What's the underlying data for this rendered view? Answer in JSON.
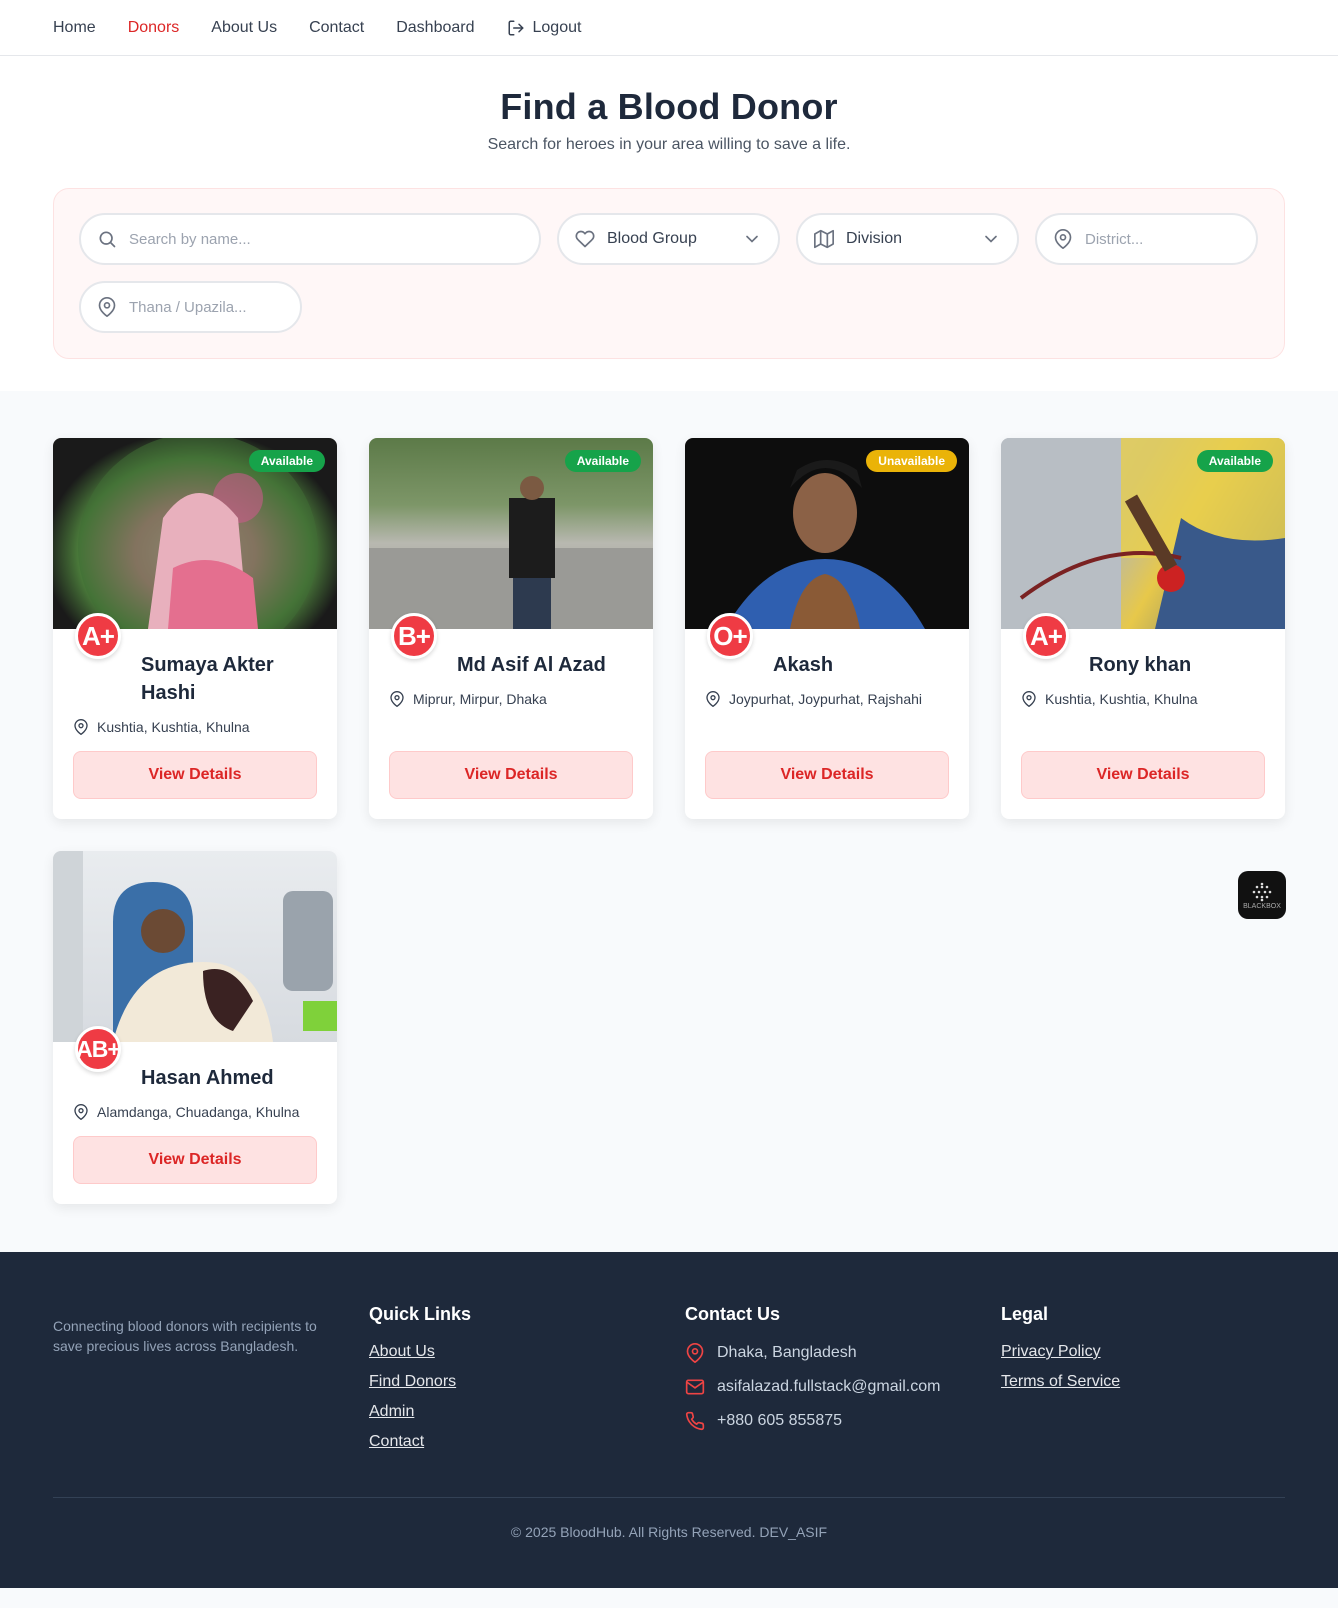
{
  "nav": {
    "items": [
      {
        "label": "Home",
        "active": false
      },
      {
        "label": "Donors",
        "active": true
      },
      {
        "label": "About Us",
        "active": false
      },
      {
        "label": "Contact",
        "active": false
      },
      {
        "label": "Dashboard",
        "active": false
      }
    ],
    "logout_label": "Logout"
  },
  "hero": {
    "title": "Find a Blood Donor",
    "subtitle": "Search for heroes in your area willing to save a life."
  },
  "filters": {
    "search_placeholder": "Search by name...",
    "blood_group": "Blood Group",
    "division": "Division",
    "district_placeholder": "District...",
    "thana_placeholder": "Thana / Upazila..."
  },
  "donors": [
    {
      "name": "Sumaya Akter Hashi",
      "blood_group": "A+",
      "status": "Available",
      "location": "Kushtia, Kushtia, Khulna",
      "button": "View Details"
    },
    {
      "name": "Md Asif Al Azad",
      "blood_group": "B+",
      "status": "Available",
      "location": "Miprur, Mirpur, Dhaka",
      "button": "View Details"
    },
    {
      "name": "Akash",
      "blood_group": "O+",
      "status": "Unavailable",
      "location": "Joypurhat, Joypurhat, Rajshahi",
      "button": "View Details"
    },
    {
      "name": "Rony khan",
      "blood_group": "A+",
      "status": "Available",
      "location": "Kushtia, Kushtia, Khulna",
      "button": "View Details"
    },
    {
      "name": "Hasan Ahmed",
      "blood_group": "AB+",
      "status": "",
      "location": "Alamdanga, Chuadanga, Khulna",
      "button": "View Details"
    }
  ],
  "widget": {
    "label": "BLACKBOX"
  },
  "footer": {
    "about": "Connecting blood donors with recipients to save precious lives across Bangladesh.",
    "quick_links": {
      "title": "Quick Links",
      "items": [
        "About Us",
        "Find Donors",
        "Admin",
        "Contact"
      ]
    },
    "contact": {
      "title": "Contact Us",
      "address": "Dhaka, Bangladesh",
      "email": "asifalazad.fullstack@gmail.com",
      "phone": "+880 605 855875"
    },
    "legal": {
      "title": "Legal",
      "items": [
        "Privacy Policy",
        "Terms of Service"
      ]
    },
    "copyright": "© 2025 BloodHub. All Rights Reserved. DEV_ASIF"
  },
  "colors": {
    "accent": "#dc2626",
    "available": "#16a34a",
    "unavailable": "#eab308",
    "footer_bg": "#1e293b"
  }
}
